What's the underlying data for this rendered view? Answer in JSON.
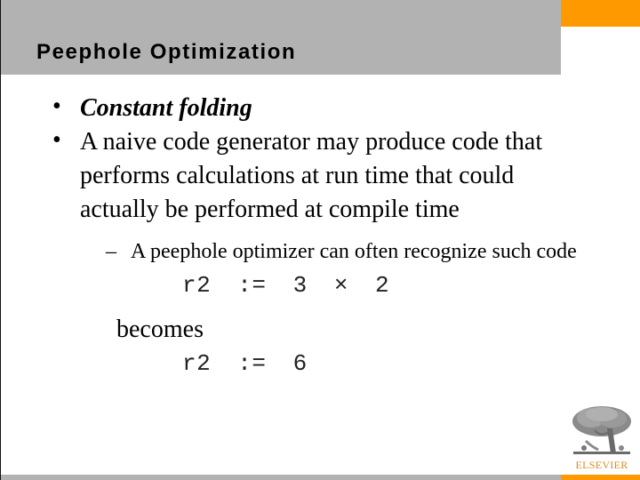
{
  "slide": {
    "title": "Peephole Optimization",
    "bullets": [
      {
        "marker": "•",
        "text": "Constant folding"
      },
      {
        "marker": "•",
        "lines": [
          "A naive code generator may produce code that",
          "performs calculations at run time that could",
          "actually be performed at compile time"
        ]
      }
    ],
    "sub_bullet": {
      "marker": "–",
      "text": "A peephole optimizer can often recognize such code"
    },
    "code_before": "r2 := 3 × 2",
    "connector": "becomes",
    "code_after": "r2 := 6",
    "logo": {
      "name": "ELSEVIER",
      "icon": "tree-icon"
    },
    "colors": {
      "header_gray": "#b2b2b2",
      "accent_orange": "#ff9900",
      "logo_text": "#e08a1e"
    }
  }
}
